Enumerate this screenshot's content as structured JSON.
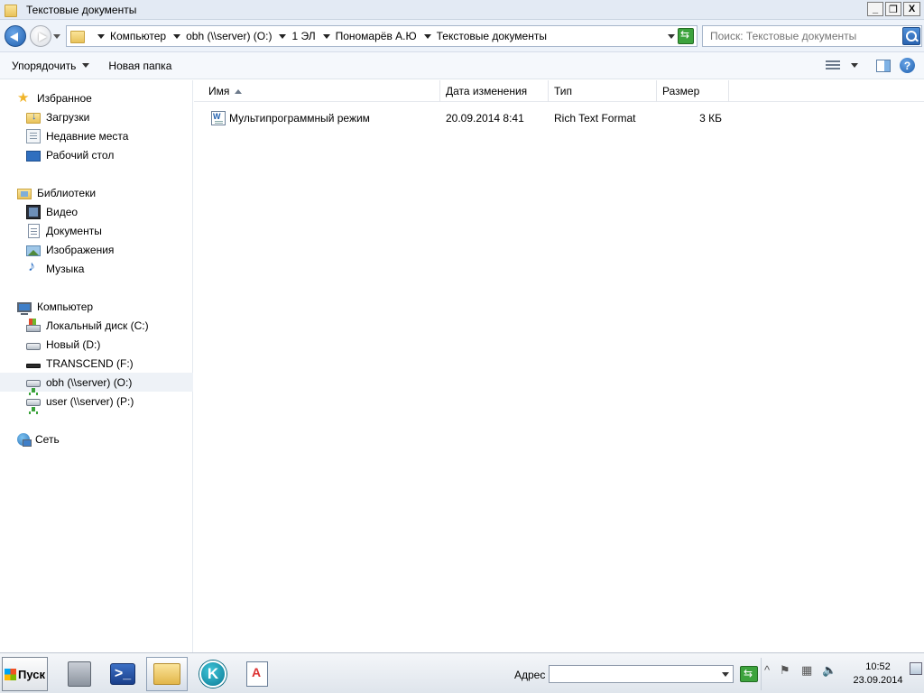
{
  "window": {
    "title": "Текстовые документы",
    "buttons": {
      "minimize": "_",
      "maximize": "❐",
      "close": "X"
    }
  },
  "address": {
    "crumbs": [
      "Компьютер",
      "obh (\\\\server) (O:)",
      "1 ЭЛ",
      "Пономарёв А.Ю",
      "Текстовые документы"
    ]
  },
  "search": {
    "placeholder": "Поиск: Текстовые документы"
  },
  "commands": {
    "organize": "Упорядочить",
    "new_folder": "Новая папка"
  },
  "nav": {
    "favorites": {
      "label": "Избранное",
      "items": [
        "Загрузки",
        "Недавние места",
        "Рабочий стол"
      ]
    },
    "libraries": {
      "label": "Библиотеки",
      "items": [
        "Видео",
        "Документы",
        "Изображения",
        "Музыка"
      ]
    },
    "computer": {
      "label": "Компьютер",
      "items": [
        "Локальный диск (C:)",
        "Новый (D:)",
        "TRANSCEND (F:)",
        "obh (\\\\server) (O:)",
        "user (\\\\server) (P:)"
      ],
      "selected_index": 3
    },
    "network": {
      "label": "Сеть"
    }
  },
  "columns": [
    "Имя",
    "Дата изменения",
    "Тип",
    "Размер"
  ],
  "files": [
    {
      "name": "Мультипрограммный режим",
      "date": "20.09.2014 8:41",
      "type": "Rich Text Format",
      "size": "3 КБ",
      "icon": "rtf-document-icon"
    }
  ],
  "taskbar": {
    "start_label": "Пуск",
    "address_label": "Адрес",
    "address_value": "",
    "tray_chevron": "^",
    "clock": {
      "time": "10:52",
      "date": "23.09.2014"
    }
  }
}
